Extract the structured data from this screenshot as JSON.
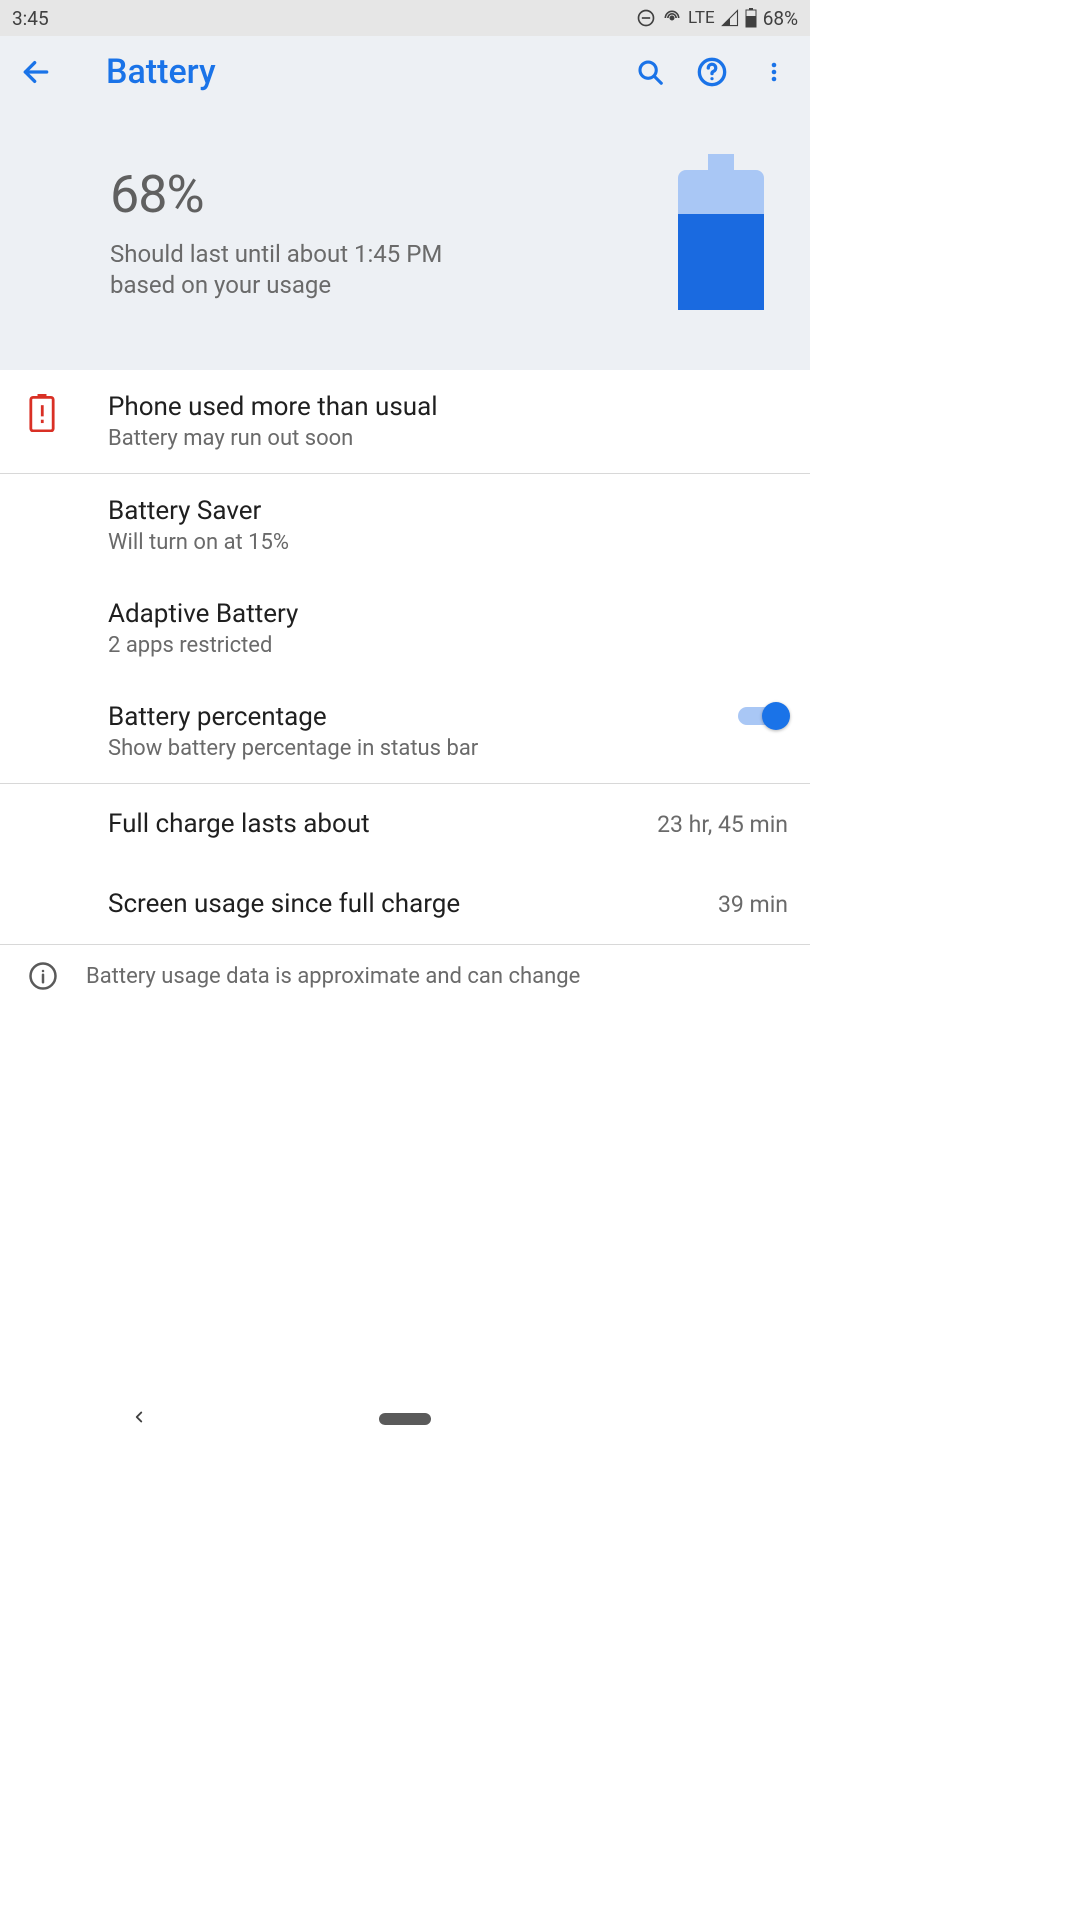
{
  "status": {
    "time": "3:45",
    "network": "LTE",
    "battery": "68%"
  },
  "header": {
    "title": "Battery"
  },
  "hero": {
    "percent": "68%",
    "subtitle": "Should last until about 1:45 PM based on your usage"
  },
  "alert": {
    "title": "Phone used more than usual",
    "subtitle": "Battery may run out soon"
  },
  "rows": {
    "saver": {
      "title": "Battery Saver",
      "subtitle": "Will turn on at 15%"
    },
    "adaptive": {
      "title": "Adaptive Battery",
      "subtitle": "2 apps restricted"
    },
    "percentage": {
      "title": "Battery percentage",
      "subtitle": "Show battery percentage in status bar",
      "enabled": true
    },
    "fullCharge": {
      "title": "Full charge lasts about",
      "value": "23 hr, 45 min"
    },
    "screenUsage": {
      "title": "Screen usage since full charge",
      "value": "39 min"
    }
  },
  "footer": {
    "note": "Battery usage data is approximate and can change"
  }
}
